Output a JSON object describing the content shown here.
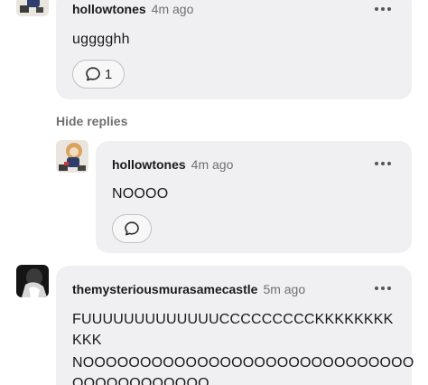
{
  "comments": [
    {
      "username": "hollowtones",
      "time": "4m ago",
      "text": "ugggghh",
      "reply_count": "1"
    },
    {
      "username": "hollowtones",
      "time": "4m ago",
      "text": "NOOOO",
      "reply_count": ""
    },
    {
      "username": "themysteriousmurasamecastle",
      "time": "5m ago",
      "text_line1": "FUUUUUUUUUUUUUCCCCCCCCCKKKKKKKK",
      "text_line2": "KKK",
      "text_line3": "NOOOOOOOOOOOOOOOOOOOOOOOOOOOOO",
      "text_line4": "OOOOOOOOOOOO"
    }
  ],
  "thread": {
    "hide_replies_label": "Hide replies"
  },
  "icons": {
    "reply": "speech-bubble-icon",
    "more": "more-dots-icon"
  },
  "colors": {
    "bubble_bg": "#f0f0f2",
    "muted_text": "#707070"
  }
}
